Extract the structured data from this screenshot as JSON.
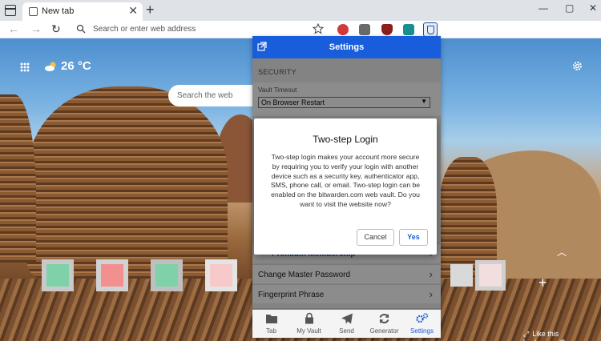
{
  "browser": {
    "tab_title": "New tab",
    "tab_close": "✕",
    "new_tab": "+",
    "address_placeholder": "Search or enter web address",
    "window_controls": [
      "—",
      "▢",
      "✕"
    ]
  },
  "new_tab_page": {
    "temperature": "26 °C",
    "search_placeholder": "Search the web",
    "like_background": "Like this background?",
    "add_tile": "+"
  },
  "popup": {
    "title": "Settings",
    "section_header": "SECURITY",
    "vault_timeout_label": "Vault Timeout",
    "vault_timeout_value": "On Browser Restart",
    "rows": [
      {
        "label": "Premium Membership"
      },
      {
        "label": "Change Master Password"
      },
      {
        "label": "Fingerprint Phrase"
      }
    ],
    "nav": [
      {
        "label": "Tab",
        "icon": "folder-icon"
      },
      {
        "label": "My Vault",
        "icon": "lock-icon"
      },
      {
        "label": "Send",
        "icon": "paper-plane-icon"
      },
      {
        "label": "Generator",
        "icon": "refresh-icon"
      },
      {
        "label": "Settings",
        "icon": "gears-icon"
      }
    ],
    "active_color": "#175ddc"
  },
  "dialog": {
    "title": "Two-step Login",
    "body": "Two-step login makes your account more secure by requiring you to verify your login with another device such as a security key, authenticator app, SMS, phone call, or email. Two-step login can be enabled on the bitwarden.com web vault. Do you want to visit the website now?",
    "cancel_label": "Cancel",
    "yes_label": "Yes"
  }
}
